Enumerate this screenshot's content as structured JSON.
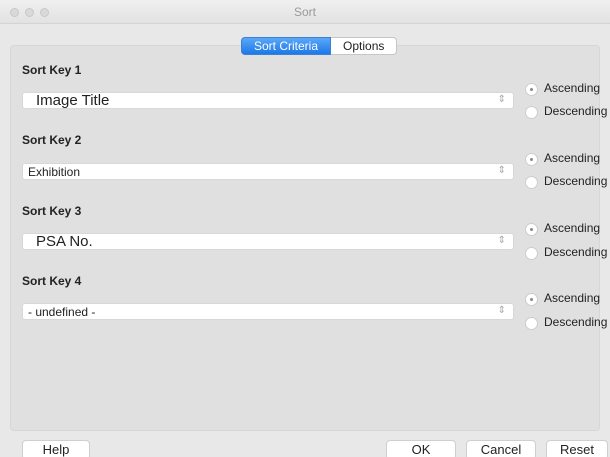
{
  "window": {
    "title": "Sort"
  },
  "tabs": [
    {
      "label": "Sort Criteria",
      "active": true
    },
    {
      "label": "Options",
      "active": false
    }
  ],
  "sort_keys": [
    {
      "label": "Sort Key 1",
      "value": "Image Title",
      "ascending_label": "Ascending",
      "descending_label": "Descending",
      "order": "ascending"
    },
    {
      "label": "Sort Key 2",
      "value": "Exhibition",
      "ascending_label": "Ascending",
      "descending_label": "Descending",
      "order": "ascending"
    },
    {
      "label": "Sort Key 3",
      "value": "PSA No.",
      "ascending_label": "Ascending",
      "descending_label": "Descending",
      "order": "ascending"
    },
    {
      "label": "Sort Key 4",
      "value": "- undefined -",
      "ascending_label": "Ascending",
      "descending_label": "Descending",
      "order": "ascending"
    }
  ],
  "buttons": {
    "help": "Help",
    "ok": "OK",
    "cancel": "Cancel",
    "reset": "Reset"
  },
  "icons": {
    "select_arrow": "up-down-chevron-icon",
    "radio": "radio-button-icon"
  },
  "colors": {
    "accent": "#1c78e8",
    "background": "#e8e8e8"
  }
}
